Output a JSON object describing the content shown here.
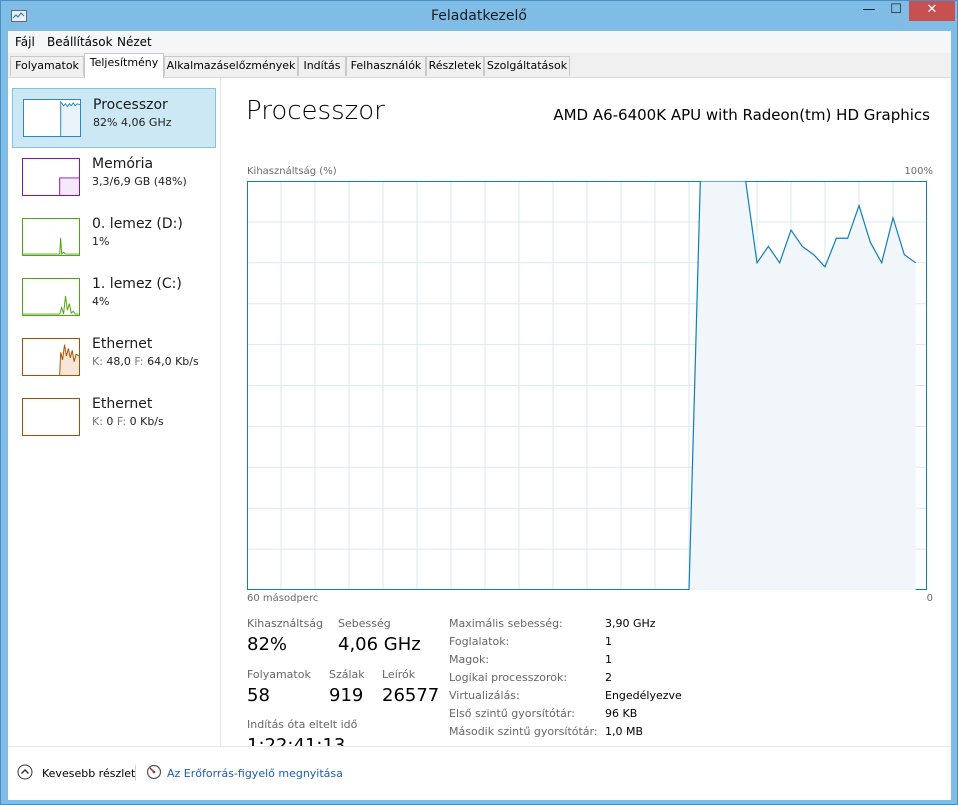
{
  "window": {
    "title": "Feladatkezelő",
    "close_glyph": "✕",
    "minimize_glyph": "—",
    "maximize_glyph": "☐"
  },
  "menu": {
    "file": "Fájl",
    "settings": "Beállítások",
    "view": "Nézet"
  },
  "tabs": [
    "Folyamatok",
    "Teljesítmény",
    "Alkalmazáselőzmények",
    "Indítás",
    "Felhasználók",
    "Részletek",
    "Szolgáltatások"
  ],
  "sidebar": [
    {
      "title": "Processzor",
      "sub": "82%  4,06 GHz",
      "color": "#2b87c0"
    },
    {
      "title": "Memória",
      "sub": "3,3/6,9 GB (48%)",
      "color": "#8b12ae"
    },
    {
      "title": "0. lemez (D:)",
      "sub": "1%",
      "color": "#4da60c"
    },
    {
      "title": "1. lemez (C:)",
      "sub": "4%",
      "color": "#4da60c"
    },
    {
      "title": "Ethernet",
      "sub_prefix_k": "K:",
      "sub_k": "48,0",
      "sub_prefix_f": "F:",
      "sub_f": "64,0 Kb/s",
      "color": "#a74f01"
    },
    {
      "title": "Ethernet",
      "sub_prefix_k": "K:",
      "sub_k": "0",
      "sub_prefix_f": "F:",
      "sub_f": "0 Kb/s",
      "color": "#a74f01"
    }
  ],
  "main": {
    "title": "Processzor",
    "cpu_name": "AMD A6-6400K APU with Radeon(tm) HD Graphics",
    "axis_top_left": "Kihasználtság (%)",
    "axis_top_right": "100%",
    "axis_bottom_left": "60 másodperc",
    "axis_bottom_right": "0"
  },
  "stats": {
    "utilization_label": "Kihasználtság",
    "utilization_value": "82%",
    "speed_label": "Sebesség",
    "speed_value": "4,06 GHz",
    "processes_label": "Folyamatok",
    "processes_value": "58",
    "threads_label": "Szálak",
    "threads_value": "919",
    "handles_label": "Leírók",
    "handles_value": "26577",
    "uptime_label": "Indítás óta eltelt idő",
    "uptime_value": "1:22:41:13"
  },
  "specs": [
    {
      "label": "Maximális sebesség:",
      "value": "3,90 GHz"
    },
    {
      "label": "Foglalatok:",
      "value": "1"
    },
    {
      "label": "Magok:",
      "value": "1"
    },
    {
      "label": "Logikai processzorok:",
      "value": "2"
    },
    {
      "label": "Virtualizálás:",
      "value": "Engedélyezve"
    },
    {
      "label": "Első szintű gyorsítótár:",
      "value": "96 KB"
    },
    {
      "label": "Második szintű gyorsítótár:",
      "value": "1,0 MB"
    }
  ],
  "bottom": {
    "fewer_details": "Kevesebb részlet",
    "open_resmon": "Az Erőforrás-figyelő megnyitása"
  },
  "chart_data": {
    "type": "line",
    "xlabel": "60 másodperc",
    "ylabel": "Kihasználtság (%)",
    "ylim": [
      0,
      100
    ],
    "x_seconds_ago": [
      60,
      59,
      58,
      57,
      56,
      55,
      54,
      53,
      52,
      51,
      50,
      49,
      48,
      47,
      46,
      45,
      44,
      43,
      42,
      41,
      40,
      39,
      38,
      37,
      36,
      35,
      34,
      33,
      32,
      31,
      30,
      29,
      28,
      27,
      26,
      25,
      24,
      23,
      22,
      21,
      20,
      19,
      18,
      17,
      16,
      15,
      14,
      13,
      12,
      11,
      10,
      9,
      8,
      7,
      6,
      5,
      4,
      3,
      2,
      1,
      0
    ],
    "series": [
      {
        "values": [
          null,
          null,
          null,
          null,
          null,
          null,
          null,
          null,
          null,
          null,
          null,
          null,
          null,
          null,
          null,
          null,
          null,
          null,
          null,
          null,
          null,
          null,
          null,
          null,
          null,
          null,
          null,
          null,
          null,
          null,
          null,
          null,
          null,
          null,
          null,
          null,
          null,
          null,
          null,
          0,
          100,
          100,
          100,
          100,
          100,
          80,
          84,
          80,
          88,
          84,
          82,
          79,
          86,
          86,
          94,
          85,
          80,
          91,
          82,
          80
        ]
      }
    ],
    "grid": true,
    "color": "#117dbb",
    "fill": "#f1f6fa"
  }
}
